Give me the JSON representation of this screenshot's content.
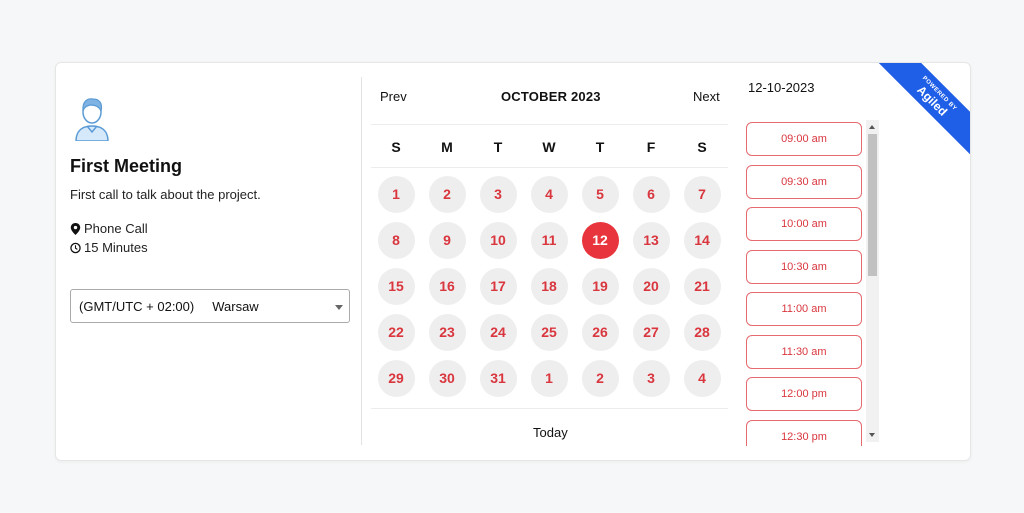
{
  "event": {
    "title": "First Meeting",
    "description": "First call to talk about the project.",
    "location": "Phone Call",
    "duration": "15 Minutes"
  },
  "timezone": {
    "offset": "(GMT/UTC + 02:00)",
    "city": "Warsaw"
  },
  "calendar": {
    "prev_label": "Prev",
    "next_label": "Next",
    "month_label": "OCTOBER 2023",
    "weekdays": [
      "S",
      "M",
      "T",
      "W",
      "T",
      "F",
      "S"
    ],
    "weeks": [
      [
        "1",
        "2",
        "3",
        "4",
        "5",
        "6",
        "7"
      ],
      [
        "8",
        "9",
        "10",
        "11",
        "12",
        "13",
        "14"
      ],
      [
        "15",
        "16",
        "17",
        "18",
        "19",
        "20",
        "21"
      ],
      [
        "22",
        "23",
        "24",
        "25",
        "26",
        "27",
        "28"
      ],
      [
        "29",
        "30",
        "31",
        "1",
        "2",
        "3",
        "4"
      ]
    ],
    "selected_day": "12",
    "today_label": "Today"
  },
  "slots": {
    "date_label": "12-10-2023",
    "times": [
      "09:00 am",
      "09:30 am",
      "10:00 am",
      "10:30 am",
      "11:00 am",
      "11:30 am",
      "12:00 pm",
      "12:30 pm"
    ]
  },
  "ribbon": {
    "top_text": "POWERED BY",
    "brand": "Agiled"
  },
  "colors": {
    "accent": "#e8353d",
    "day_bg": "#eeeeee",
    "ribbon": "#1f5ee6"
  }
}
